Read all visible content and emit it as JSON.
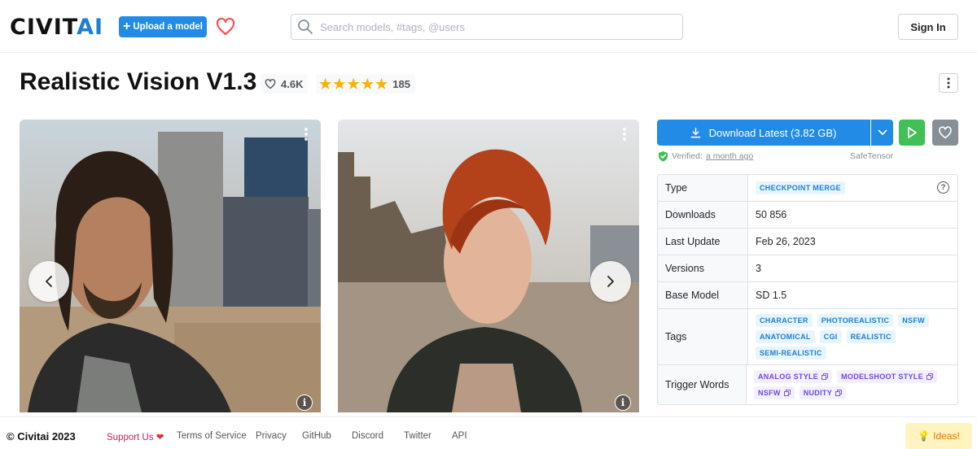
{
  "header": {
    "logo_part1": "CIVIT",
    "logo_part2": "AI",
    "upload_label": "Upload a model",
    "search_placeholder": "Search models, #tags, @users",
    "signin_label": "Sign In"
  },
  "model": {
    "title": "Realistic Vision V1.3",
    "likes": "4.6K",
    "rating_count": "185",
    "rating_stars": 5
  },
  "download": {
    "label": "Download Latest (3.82 GB)",
    "verified_label": "Verified:",
    "verified_time": "a month ago",
    "format": "SafeTensor"
  },
  "details": {
    "type_label": "Type",
    "type_value": "CHECKPOINT MERGE",
    "downloads_label": "Downloads",
    "downloads_value": "50 856",
    "last_update_label": "Last Update",
    "last_update_value": "Feb 26, 2023",
    "versions_label": "Versions",
    "versions_value": "3",
    "base_model_label": "Base Model",
    "base_model_value": "SD 1.5",
    "tags_label": "Tags",
    "tags": [
      "CHARACTER",
      "PHOTOREALISTIC",
      "NSFW",
      "ANATOMICAL",
      "CGI",
      "REALISTIC",
      "SEMI-REALISTIC"
    ],
    "trigger_label": "Trigger Words",
    "trigger_words": [
      "ANALOG STYLE",
      "MODELSHOOT STYLE",
      "NSFW",
      "NUDITY"
    ]
  },
  "footer": {
    "copyright": "© Civitai 2023",
    "support": "Support Us",
    "terms": "Terms of Service",
    "privacy": "Privacy",
    "github": "GitHub",
    "discord": "Discord",
    "twitter": "Twitter",
    "api": "API",
    "ideas": "Ideas!"
  },
  "colors": {
    "brand_blue": "#228be6",
    "play_green": "#40c057",
    "star_yellow": "#fab005"
  }
}
